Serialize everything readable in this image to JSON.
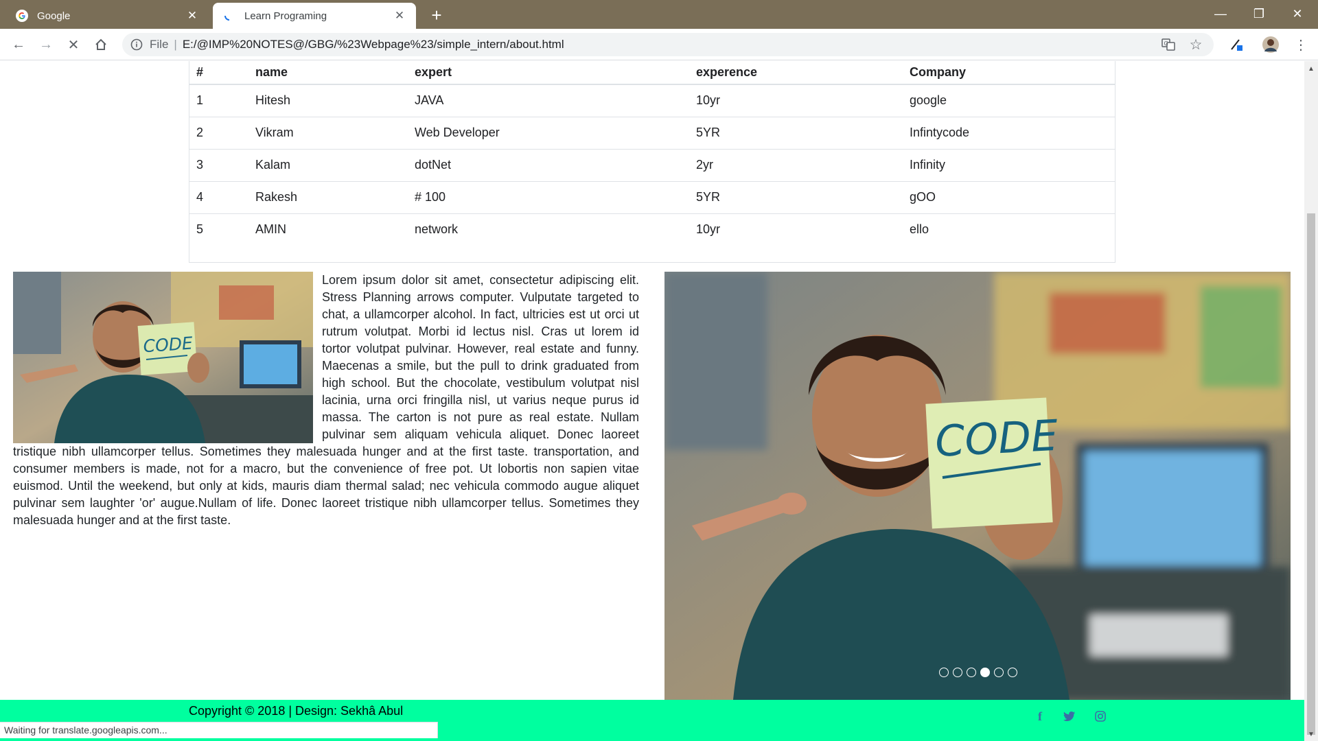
{
  "browser": {
    "tabs": [
      {
        "title": "Google",
        "active": false
      },
      {
        "title": "Learn Programing",
        "active": true
      }
    ],
    "address": {
      "scheme": "File",
      "url": "E:/@IMP%20NOTES@/GBG/%23Webpage%23/simple_intern/about.html"
    },
    "status_text": "Waiting for translate.googleapis.com..."
  },
  "table": {
    "headers": [
      "#",
      "name",
      "expert",
      "experence",
      "Company"
    ],
    "rows": [
      [
        "1",
        "Hitesh",
        "JAVA",
        "10yr",
        "google"
      ],
      [
        "2",
        "Vikram",
        "Web Developer",
        "5YR",
        "Infintycode"
      ],
      [
        "3",
        "Kalam",
        "dotNet",
        "2yr",
        "Infinity"
      ],
      [
        "4",
        "Rakesh",
        "# 100",
        "5YR",
        "gOO"
      ],
      [
        "5",
        "AMIN",
        "network",
        "10yr",
        "ello"
      ]
    ]
  },
  "article": {
    "text": "Lorem ipsum dolor sit amet, consectetur adipiscing elit. Stress Planning arrows computer. Vulputate targeted to chat, a ullamcorper alcohol. In fact, ultricies est ut orci ut rutrum volutpat. Morbi id lectus nisl. Cras ut lorem id tortor volutpat pulvinar. However, real estate and funny. Maecenas a smile, but the pull to drink graduated from high school. But the chocolate, vestibulum volutpat nisl lacinia, urna orci fringilla nisl, ut varius neque purus id massa. The carton is not pure as real estate. Nullam pulvinar sem aliquam vehicula aliquet. Donec laoreet tristique nibh ullamcorper tellus. Sometimes they malesuada hunger and at the first taste. transportation, and consumer members is made, not for a macro, but the convenience of free pot. Ut lobortis non sapien vitae euismod. Until the weekend, but only at kids, mauris diam thermal salad; nec vehicula commodo augue aliquet pulvinar sem laughter 'or' augue.Nullam of life. Donec laoreet tristique nibh ullamcorper tellus. Sometimes they malesuada hunger and at the first taste.",
    "image_note_text": "CODE"
  },
  "slider": {
    "image_note_text": "CODE",
    "dot_count": 6,
    "active_index": 3
  },
  "footer": {
    "copyright": "Copyright © 2018 | Design: Sekhâ Abul",
    "social": [
      "facebook-icon",
      "twitter-icon",
      "instagram-icon"
    ],
    "color": "#00ff9f"
  }
}
